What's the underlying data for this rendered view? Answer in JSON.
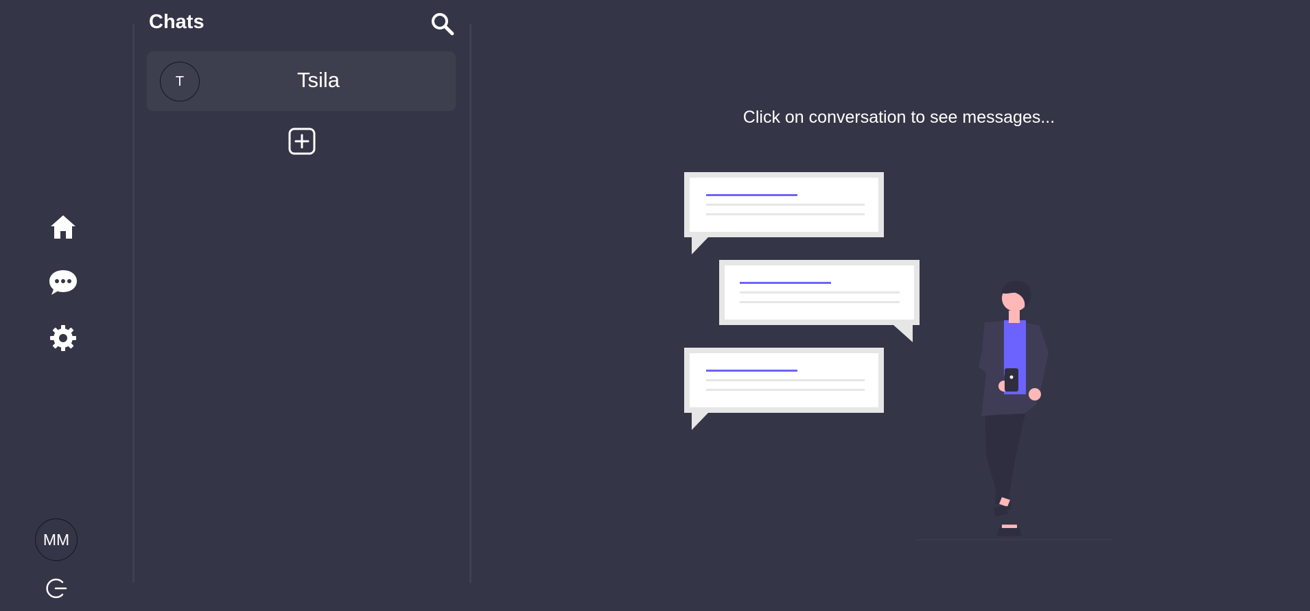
{
  "sidebar": {
    "nav": [
      {
        "name": "home",
        "icon": "home-icon"
      },
      {
        "name": "chats",
        "icon": "chat-bubble-icon"
      },
      {
        "name": "settings",
        "icon": "gear-icon"
      }
    ],
    "user_initials": "MM",
    "logout_icon": "logout-icon"
  },
  "chat_list": {
    "title": "Chats",
    "search_icon": "search-icon",
    "items": [
      {
        "initial": "T",
        "name": "Tsila"
      }
    ],
    "add_icon": "add-square-icon"
  },
  "main": {
    "placeholder": "Click on conversation to see messages...",
    "illustration": "person-with-message-bubbles"
  },
  "colors": {
    "background": "#343546",
    "panel_item": "#3e3f4e",
    "accent": "#6c63ff",
    "divider": "#3f4051"
  }
}
